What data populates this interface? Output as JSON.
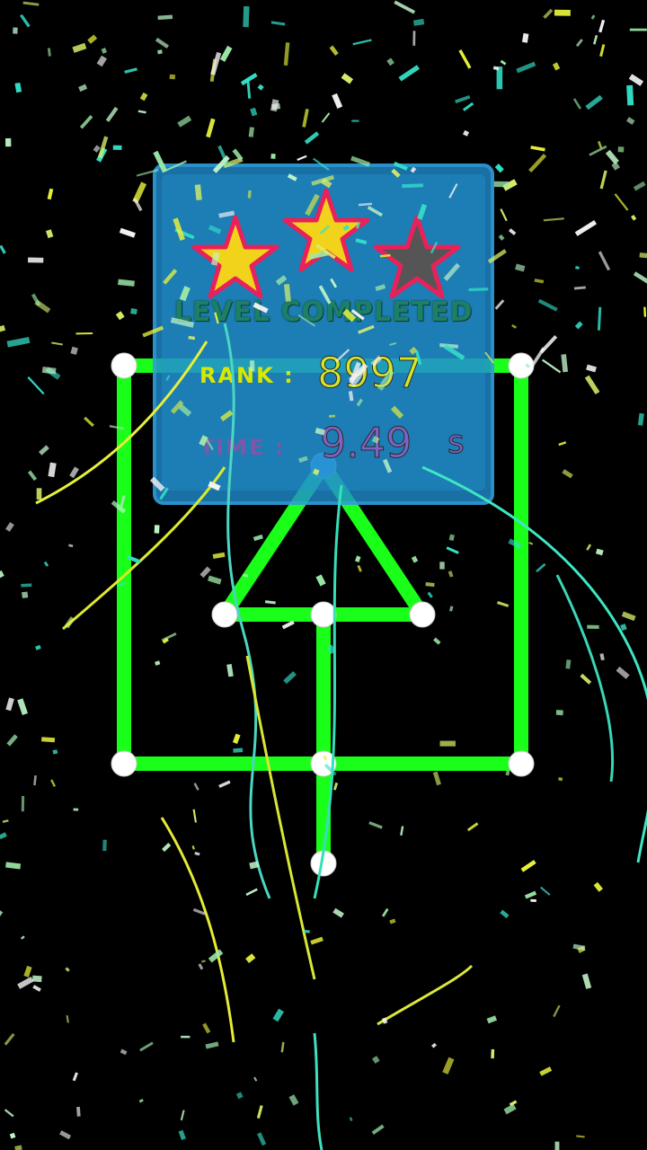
{
  "level_complete": {
    "stars_earned": 2,
    "stars_total": 3,
    "title": "LEVEL COMPLETED",
    "rank_label": "RANK :",
    "rank_value": "8997",
    "time_label": "TIME :",
    "time_value": "9.49",
    "time_unit": "s"
  },
  "colors": {
    "background": "#000000",
    "line": "#19ff19",
    "node": "#ffffff",
    "active_node": "#4aa8f0",
    "panel": "#1e8ccd",
    "star_gold": "#f2d31b",
    "star_empty": "#555555",
    "star_border": "#e8215a"
  }
}
